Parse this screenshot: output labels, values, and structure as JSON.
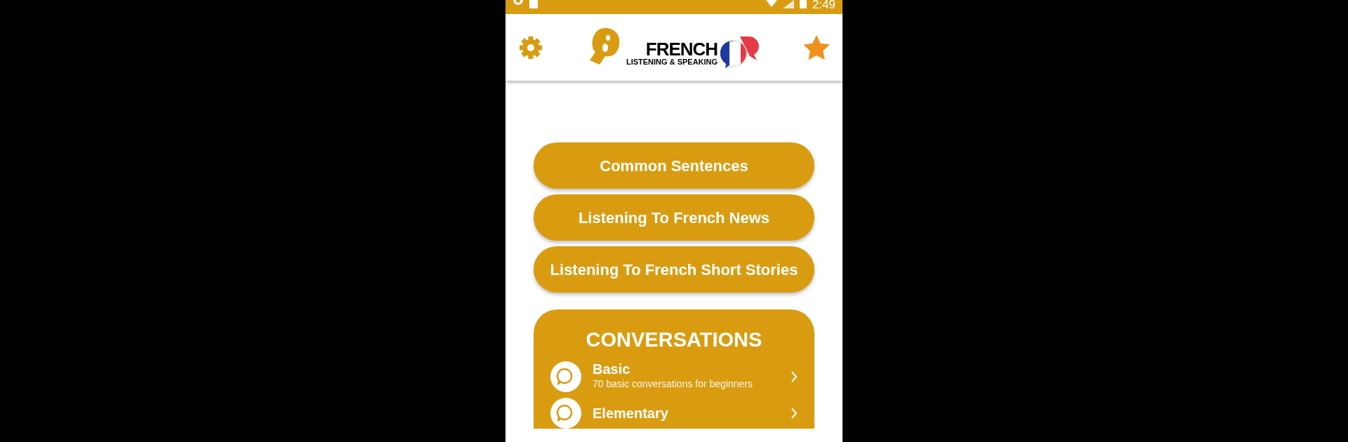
{
  "status_bar": {
    "time": "2:49"
  },
  "header": {
    "logo_title": "FRENCH",
    "logo_subtitle": "LISTENING & SPEAKING"
  },
  "menu_buttons": [
    {
      "label": "Common Sentences"
    },
    {
      "label": "Listening To French News"
    },
    {
      "label": "Listening To French Short Stories"
    }
  ],
  "conversations": {
    "title": "CONVERSATIONS",
    "items": [
      {
        "title": "Basic",
        "subtitle": "70 basic conversations for beginners"
      },
      {
        "title": "Elementary"
      }
    ]
  }
}
